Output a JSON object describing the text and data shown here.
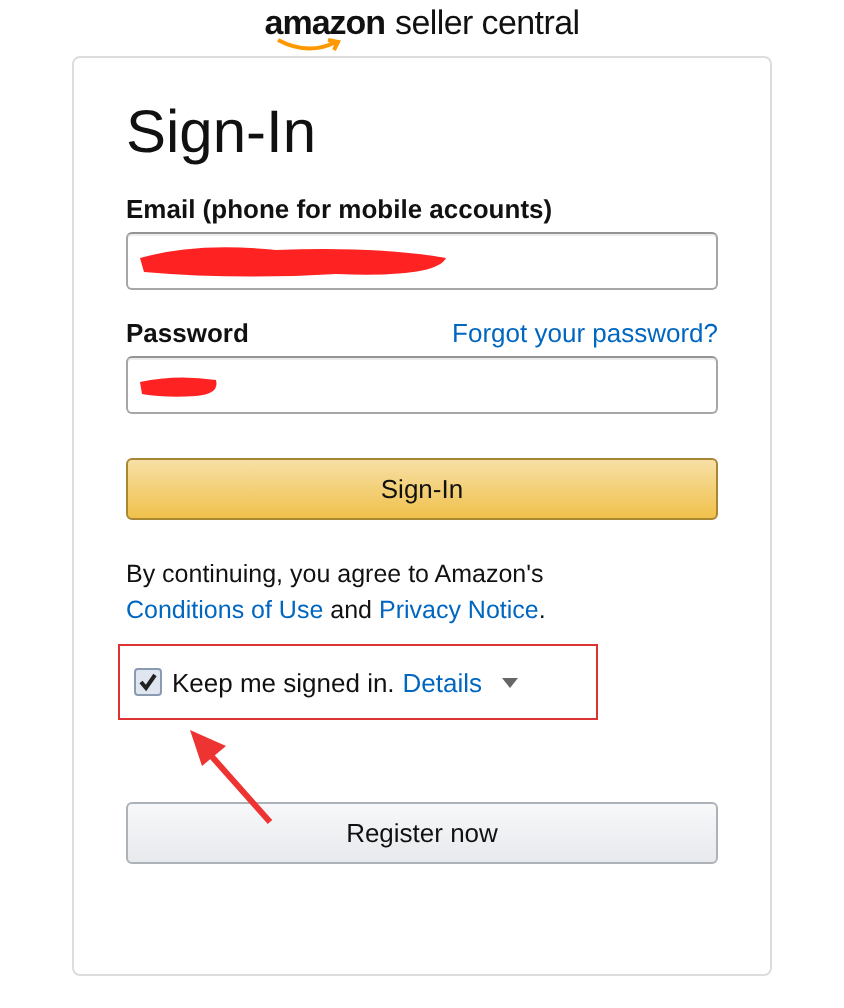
{
  "logo": {
    "brand": "amazon",
    "product": "seller central"
  },
  "title": "Sign-In",
  "email": {
    "label": "Email (phone for mobile accounts)"
  },
  "password": {
    "label": "Password",
    "forgot_link": "Forgot your password?"
  },
  "sign_in_button": "Sign-In",
  "legal": {
    "prefix": "By continuing, you agree to Amazon's ",
    "conditions_link": "Conditions of Use",
    "middle": " and ",
    "privacy_link": "Privacy Notice",
    "suffix": "."
  },
  "keep_signed_in": {
    "label": "Keep me signed in.",
    "checked": true,
    "details_link": "Details"
  },
  "register_button": "Register now"
}
